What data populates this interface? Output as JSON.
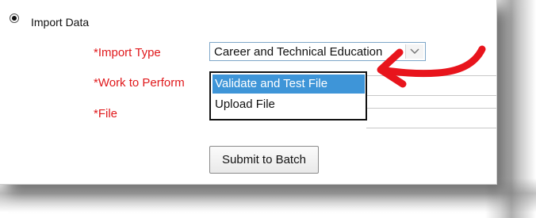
{
  "import_data": {
    "label": "Import Data",
    "selected": true
  },
  "fields": {
    "import_type_label": "*Import Type",
    "work_label": "*Work to Perform",
    "file_label": "*File"
  },
  "import_type": {
    "value": "Career and Technical Education"
  },
  "work_dropdown": {
    "options": [
      "Validate and Test File",
      "Upload File"
    ],
    "selected_index": 0
  },
  "submit_label": "Submit to Batch",
  "colors": {
    "label_red": "#e0181b",
    "highlight_blue": "#3e95d8",
    "annotation_arrow": "#e8141c"
  },
  "icons": {
    "radio": "radio-button-selected-icon",
    "select_arrow": "chevron-down-icon",
    "annotation": "curved-arrow-annotation"
  }
}
